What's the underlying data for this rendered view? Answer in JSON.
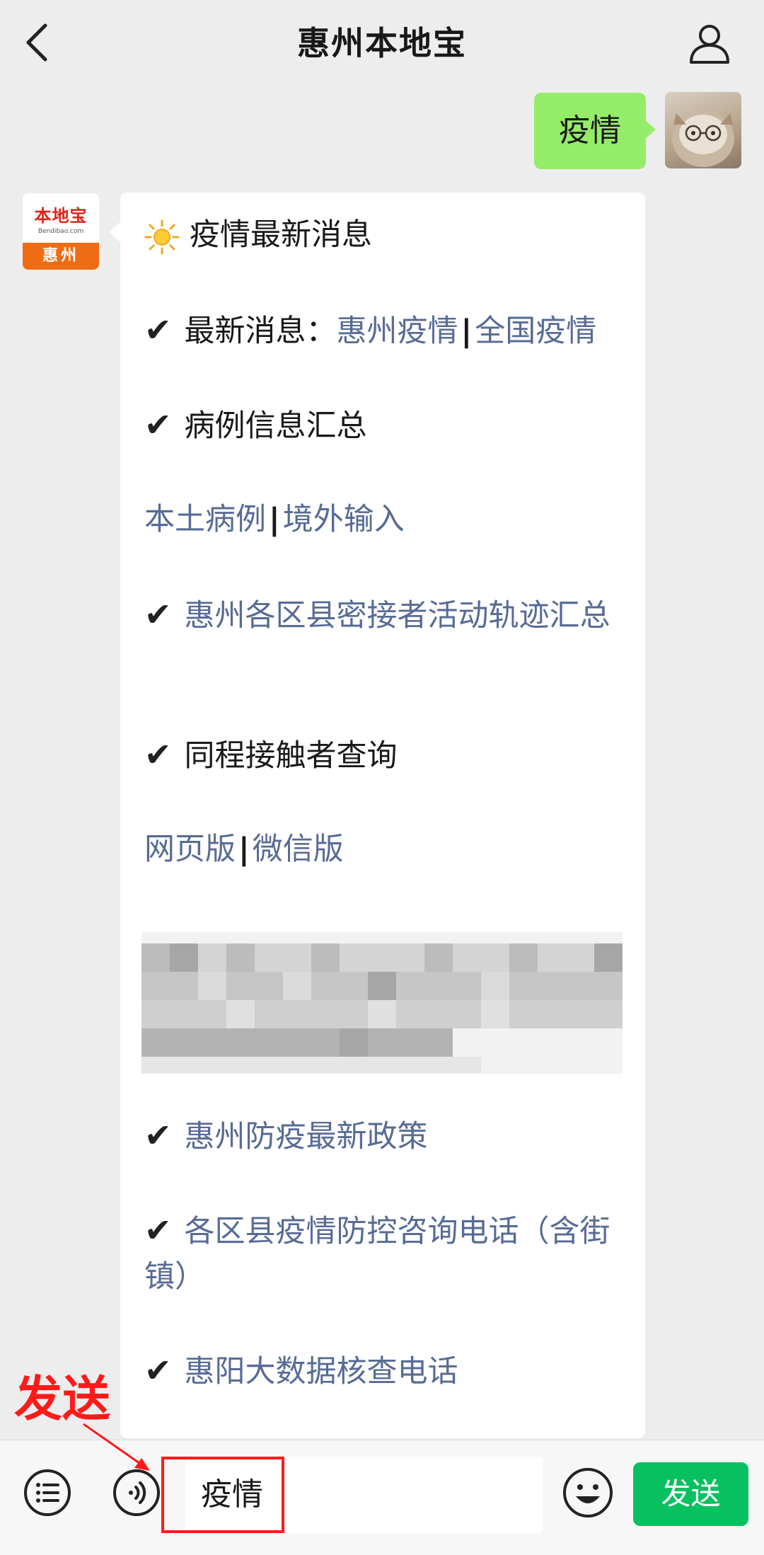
{
  "header": {
    "title": "惠州本地宝",
    "back_icon": "chevron-left-icon",
    "profile_icon": "user-icon"
  },
  "outgoing": {
    "text": "疫情"
  },
  "bot_avatar": {
    "logo_name": "本地宝",
    "logo_url": "Bendibao.com",
    "logo_city": "惠州"
  },
  "card": {
    "title": "疫情最新消息",
    "latest_label": "最新消息：",
    "latest_link1": "惠州疫情",
    "latest_sep": "|",
    "latest_link2": "全国疫情",
    "cases_summary": "病例信息汇总",
    "local_cases": "本土病例",
    "cases_sep": "|",
    "imported_cases": "境外输入",
    "check": "✔",
    "trajectory": "惠州各区县密接者活动轨迹汇总",
    "same_trip": "同程接触者查询",
    "web_version": "网页版",
    "version_sep": "|",
    "wechat_version": "微信版",
    "policy": "惠州防疫最新政策",
    "hotline": "各区县疫情防控咨询电话（含街镇）",
    "bigdata": "惠阳大数据核查电话"
  },
  "input_bar": {
    "input_value": "疫情",
    "send_label": "发送",
    "menu_icon": "list-icon",
    "voice_icon": "voice-icon",
    "emoji_icon": "emoji-icon"
  },
  "annotation": {
    "label": "发送",
    "color": "#ff1a1a"
  },
  "colors": {
    "background": "#ededed",
    "outgoing_bubble": "#95ec69",
    "link": "#576b95",
    "send_button": "#07c160",
    "logo_orange": "#ef6c14"
  }
}
